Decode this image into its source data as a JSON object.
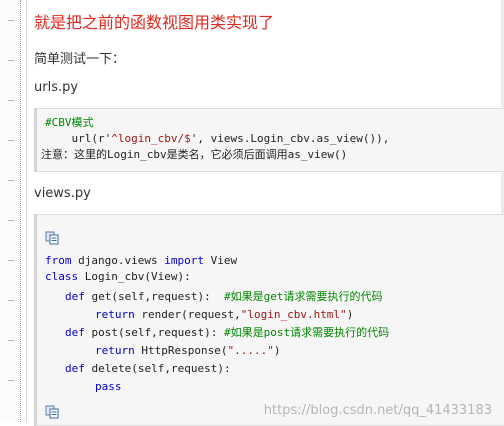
{
  "heading": "就是把之前的函数视图用类实现了",
  "intro": "简单测试一下：",
  "urls_file": "urls.py",
  "urls_code": {
    "line1_comment": "#CBV模式",
    "line2_pre": "    url(r'",
    "line2_str": "^login_cbv/$",
    "line2_post": "', views.Login_cbv.as_view()),",
    "line3": "注意：这里的Login_cbv是类名，它必须后面调用as_view()"
  },
  "views_file": "views.py",
  "views_code": {
    "l1_kw1": "from",
    "l1_mid": " django.views ",
    "l1_kw2": "import",
    "l1_end": " View",
    "l2_kw": "class",
    "l2_rest": " Login_cbv(View):",
    "l3_kw": "def",
    "l3_rest": " get(self,request):  ",
    "l3_cmt": "#如果是get请求需要执行的代码",
    "l4_kw": "return",
    "l4_rest": " render(request,",
    "l4_str": "\"login_cbv.html\"",
    "l4_end": ")",
    "l5_kw": "def",
    "l5_rest": " post(self,request): ",
    "l5_cmt": "#如果是post请求需要执行的代码",
    "l6_kw": "return",
    "l6_rest": " HttpResponse(",
    "l6_str": "\".....\"",
    "l6_end": ")",
    "l7_kw": "def",
    "l7_rest": " delete(self,request):",
    "l8_kw": "pass"
  },
  "watermark": "https://blog.csdn.net/qq_41433183"
}
